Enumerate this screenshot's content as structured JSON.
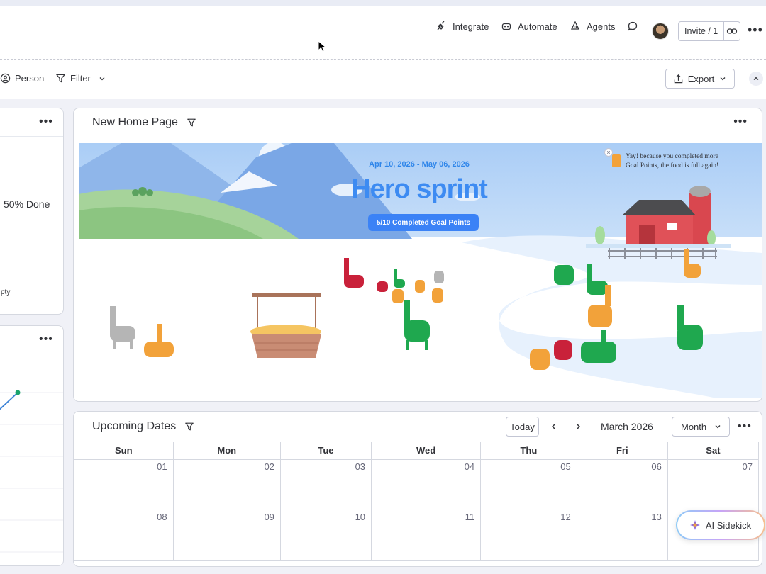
{
  "topbar": {
    "integrate": "Integrate",
    "automate": "Automate",
    "agents": "Agents",
    "invite": "Invite / 1"
  },
  "filterbar": {
    "person": "Person",
    "filter": "Filter",
    "export": "Export"
  },
  "left_widget_top": {
    "status": "50% Done",
    "legend_fragment": "pty"
  },
  "hero_widget": {
    "title": "New Home Page",
    "banner": {
      "dates": "Apr 10, 2026 - May 06, 2026",
      "title": "Hero sprint",
      "pill": "5/10 Completed Goal Points",
      "notice": "Yay! because you completed more Goal Points, the food is full again!"
    }
  },
  "calendar": {
    "title": "Upcoming Dates",
    "today": "Today",
    "month_label": "March 2026",
    "view": "Month",
    "weekdays": [
      "Sun",
      "Mon",
      "Tue",
      "Wed",
      "Thu",
      "Fri",
      "Sat"
    ],
    "weeks": [
      [
        "01",
        "02",
        "03",
        "04",
        "05",
        "06",
        "07"
      ],
      [
        "08",
        "09",
        "10",
        "11",
        "12",
        "13",
        ""
      ]
    ]
  },
  "sidekick": {
    "label": "AI Sidekick"
  },
  "colors": {
    "accent_blue": "#3b82f6",
    "hero_title": "#3d8bf2",
    "llama_green": "#1fa84f",
    "llama_orange": "#f2a23a",
    "llama_red": "#c9213a",
    "llama_grey": "#b5b5b5"
  }
}
